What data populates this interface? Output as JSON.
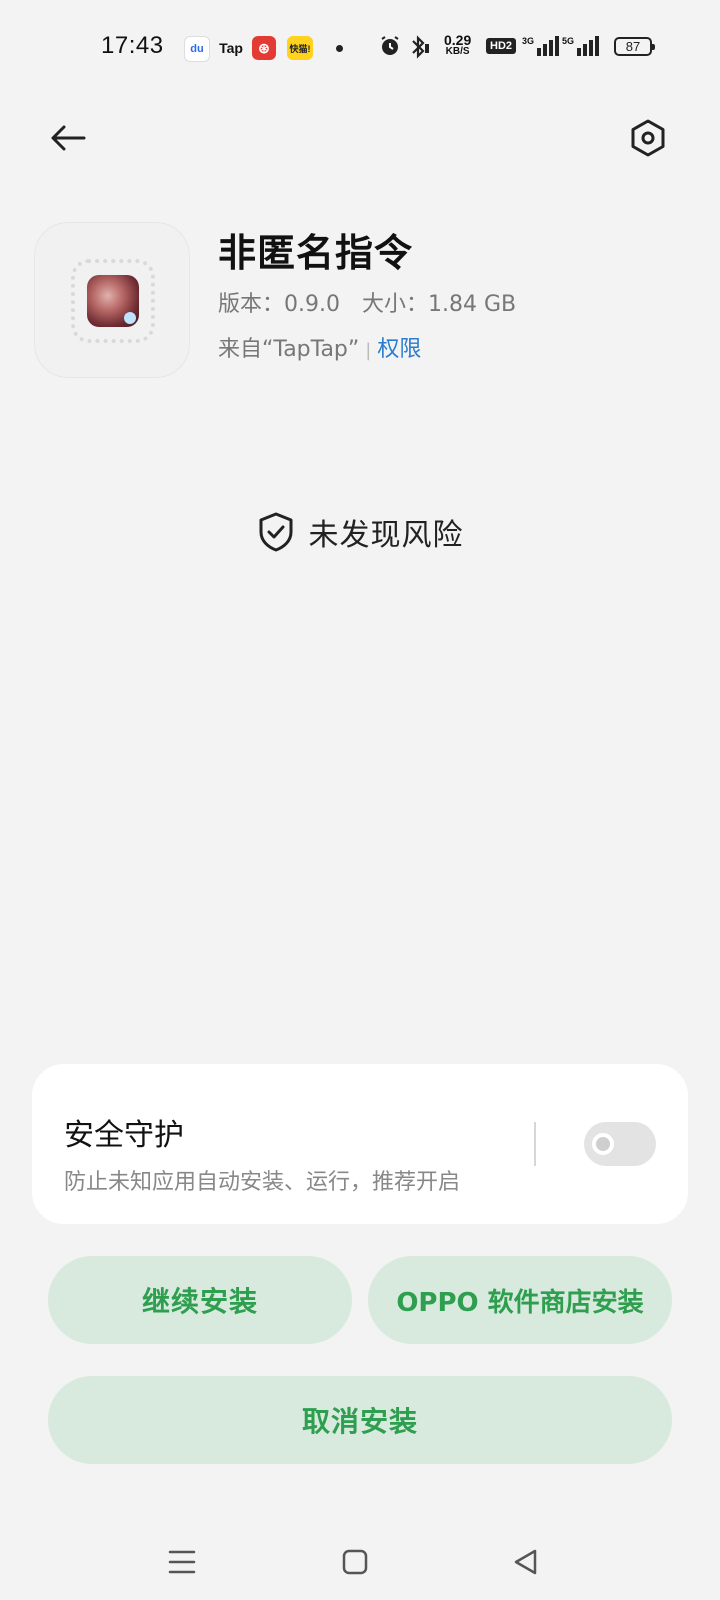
{
  "status_bar": {
    "time": "17:43",
    "app_icons": {
      "baidu": "du",
      "tap": "Tap",
      "netease": "⊛",
      "kuaishou": "快猫!"
    },
    "net_speed_value": "0.29",
    "net_speed_unit": "KB/S",
    "hd_label": "HD2",
    "signal1_label": "3G",
    "signal2_label": "5G",
    "battery": "87"
  },
  "header": {
    "back_icon": "arrow-left-icon",
    "settings_icon": "settings-hexagon-icon"
  },
  "app": {
    "name": "非匿名指令",
    "version_label": "版本：0.9.0",
    "size_label": "大小：1.84 GB",
    "source_text": "来自“TapTap”",
    "separator": "|",
    "permissions_link": "权限"
  },
  "risk": {
    "text": "未发现风险",
    "icon": "shield-check-icon"
  },
  "security_guard": {
    "title": "安全守护",
    "description": "防止未知应用自动安装、运行，推荐开启",
    "enabled": false
  },
  "buttons": {
    "continue": "继续安装",
    "store_install": "OPPO 软件商店安装",
    "cancel": "取消安装"
  },
  "colors": {
    "accent_green": "#2e9e4f",
    "button_bg": "#d8e9de",
    "link_blue": "#2a7ccf",
    "page_bg": "#f3f3f3"
  }
}
